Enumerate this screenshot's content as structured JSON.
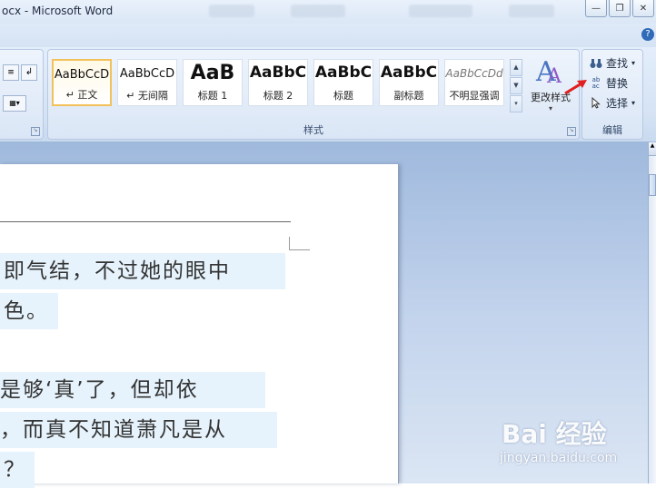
{
  "window": {
    "title": "ocx - Microsoft Word",
    "controls": [
      "minimize-icon",
      "restore-icon",
      "close-icon"
    ],
    "help_icon": "?"
  },
  "ribbon": {
    "styles_group": {
      "label": "样式",
      "styles": [
        {
          "sample": "AaBbCcD",
          "name": "↵ 正文",
          "active": true
        },
        {
          "sample": "AaBbCcD",
          "name": "↵ 无间隔",
          "active": false
        },
        {
          "sample": "AaB",
          "name": "标题 1",
          "active": false
        },
        {
          "sample": "AaBbC",
          "name": "标题 2",
          "active": false
        },
        {
          "sample": "AaBbC",
          "name": "标题",
          "active": false
        },
        {
          "sample": "AaBbC",
          "name": "副标题",
          "active": false
        },
        {
          "sample": "AaBbCcDd",
          "name": "不明显强调",
          "active": false
        }
      ],
      "change_styles_label": "更改样式"
    },
    "edit_group": {
      "label": "编辑",
      "find_label": "查找",
      "replace_label": "替换",
      "select_label": "选择"
    }
  },
  "document": {
    "lines": [
      "即气结，不过她的眼中",
      "色。",
      "是够‘真’了，但却依",
      "，而真不知道萧凡是从",
      "？"
    ]
  },
  "watermark": {
    "logo": "Bai 经验",
    "url": "jingyan.baidu.com"
  },
  "colors": {
    "accent": "#2f6bb8",
    "highlight": "#e6f3fc",
    "arrow": "#e02020"
  }
}
